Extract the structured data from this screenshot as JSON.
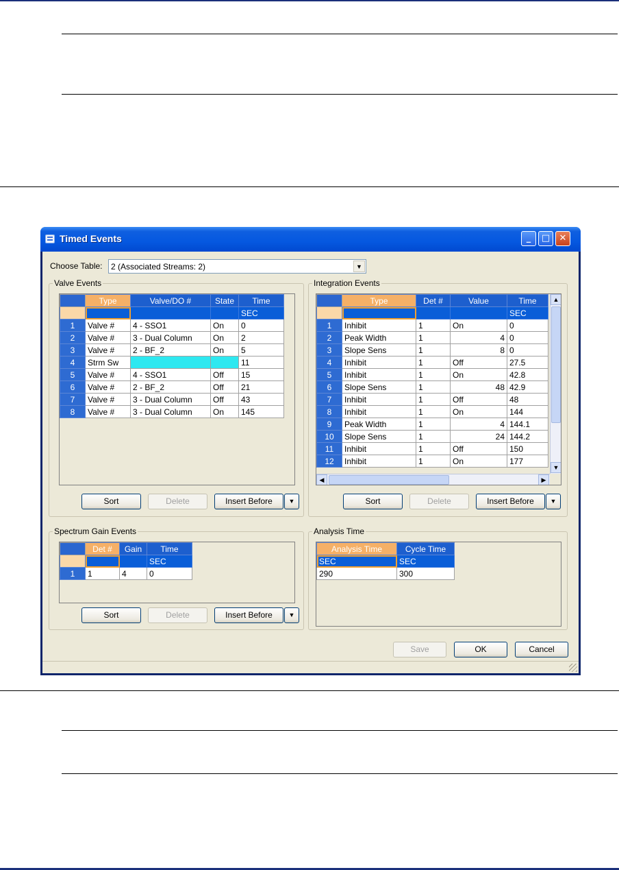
{
  "window": {
    "title": "Timed Events"
  },
  "choose_table": {
    "label": "Choose Table:",
    "value": "2 (Associated Streams: 2)"
  },
  "valve_events": {
    "label": "Valve Events",
    "columns": [
      "Type",
      "Valve/DO #",
      "State",
      "Time"
    ],
    "units": [
      "",
      "",
      "",
      "SEC"
    ],
    "rows": [
      {
        "n": "1",
        "type": "Valve #",
        "valve": "4 - SSO1",
        "state": "On",
        "time": "0"
      },
      {
        "n": "2",
        "type": "Valve #",
        "valve": "3 - Dual Column",
        "state": "On",
        "time": "2"
      },
      {
        "n": "3",
        "type": "Valve #",
        "valve": "2 - BF_2",
        "state": "On",
        "time": "5"
      },
      {
        "n": "4",
        "type": "Strm Sw",
        "valve": "",
        "state": "",
        "time": "11"
      },
      {
        "n": "5",
        "type": "Valve #",
        "valve": "4 - SSO1",
        "state": "Off",
        "time": "15"
      },
      {
        "n": "6",
        "type": "Valve #",
        "valve": "2 - BF_2",
        "state": "Off",
        "time": "21"
      },
      {
        "n": "7",
        "type": "Valve #",
        "valve": "3 - Dual Column",
        "state": "Off",
        "time": "43"
      },
      {
        "n": "8",
        "type": "Valve #",
        "valve": "3 - Dual Column",
        "state": "On",
        "time": "145"
      }
    ]
  },
  "integration_events": {
    "label": "Integration Events",
    "columns": [
      "Type",
      "Det #",
      "Value",
      "Time"
    ],
    "units": [
      "",
      "",
      "",
      "SEC"
    ],
    "rows": [
      {
        "n": "1",
        "type": "Inhibit",
        "det": "1",
        "value": "On",
        "time": "0"
      },
      {
        "n": "2",
        "type": "Peak Width",
        "det": "1",
        "value": "4",
        "time": "0"
      },
      {
        "n": "3",
        "type": "Slope Sens",
        "det": "1",
        "value": "8",
        "time": "0"
      },
      {
        "n": "4",
        "type": "Inhibit",
        "det": "1",
        "value": "Off",
        "time": "27.5"
      },
      {
        "n": "5",
        "type": "Inhibit",
        "det": "1",
        "value": "On",
        "time": "42.8"
      },
      {
        "n": "6",
        "type": "Slope Sens",
        "det": "1",
        "value": "48",
        "time": "42.9"
      },
      {
        "n": "7",
        "type": "Inhibit",
        "det": "1",
        "value": "Off",
        "time": "48"
      },
      {
        "n": "8",
        "type": "Inhibit",
        "det": "1",
        "value": "On",
        "time": "144"
      },
      {
        "n": "9",
        "type": "Peak Width",
        "det": "1",
        "value": "4",
        "time": "144.1"
      },
      {
        "n": "10",
        "type": "Slope Sens",
        "det": "1",
        "value": "24",
        "time": "144.2"
      },
      {
        "n": "11",
        "type": "Inhibit",
        "det": "1",
        "value": "Off",
        "time": "150"
      },
      {
        "n": "12",
        "type": "Inhibit",
        "det": "1",
        "value": "On",
        "time": "177"
      }
    ]
  },
  "spectrum_gain_events": {
    "label": "Spectrum Gain Events",
    "columns": [
      "Det #",
      "Gain",
      "Time"
    ],
    "units": [
      "",
      "",
      "SEC"
    ],
    "rows": [
      {
        "n": "1",
        "det": "1",
        "gain": "4",
        "time": "0"
      }
    ]
  },
  "analysis_time": {
    "label": "Analysis Time",
    "columns": [
      "Analysis Time",
      "Cycle Time"
    ],
    "units": [
      "SEC",
      "SEC"
    ],
    "values": [
      "290",
      "300"
    ]
  },
  "buttons": {
    "sort": "Sort",
    "delete": "Delete",
    "insert_before": "Insert Before",
    "save": "Save",
    "ok": "OK",
    "cancel": "Cancel"
  },
  "colors": {
    "title_bar": "#0558e0",
    "header_blue": "#1d5fce",
    "selected_header": "#f5b067",
    "highlight_cyan": "#2ee8f0"
  }
}
